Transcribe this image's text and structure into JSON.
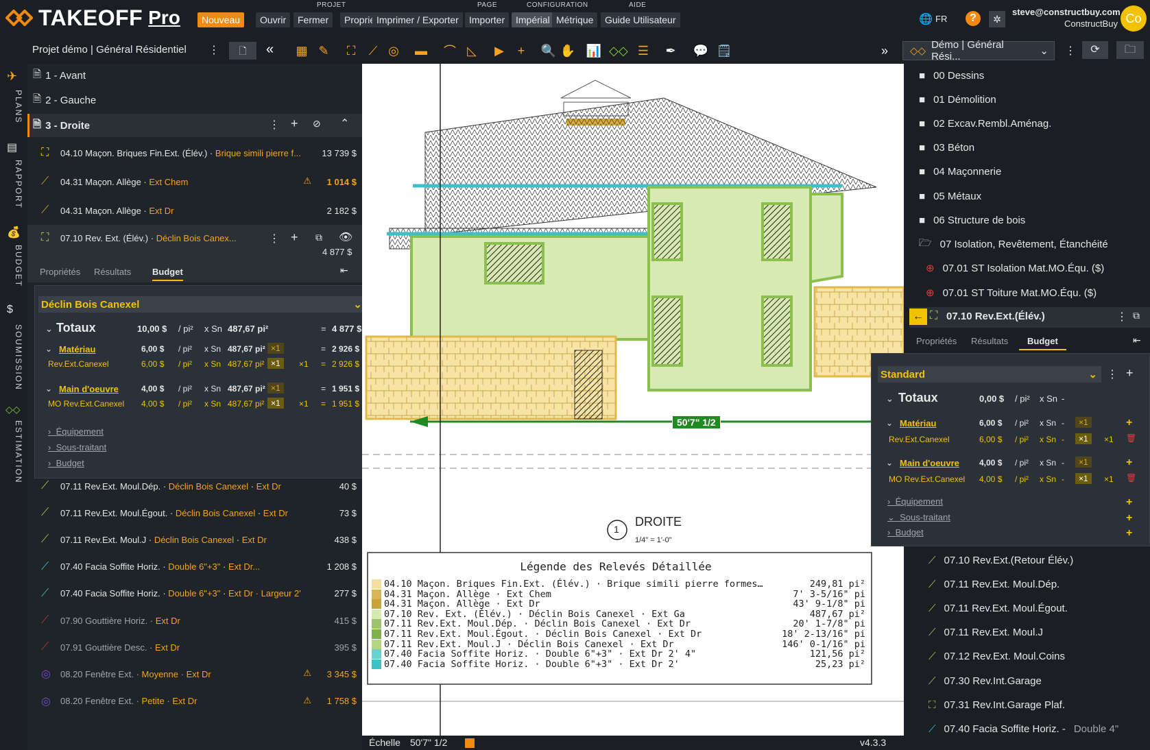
{
  "app": {
    "name_main": "TAKEOFF",
    "name_pro": "Pro",
    "lang": "FR",
    "user_email": "steve@constructbuy.com",
    "user_company": "ConstructBuy",
    "avatar": "Co"
  },
  "menu_groups": {
    "projet": "PROJET",
    "page": "PAGE",
    "configuration": "CONFIGURATION",
    "aide": "AIDE"
  },
  "menu": {
    "nouveau": "Nouveau",
    "ouvrir": "Ouvrir",
    "fermer": "Fermer",
    "proprietes": "Propriétés",
    "imprimer": "Imprimer / Exporter",
    "importer": "Importer",
    "imperial": "Impérial",
    "metrique": "Métrique",
    "guide": "Guide Utilisateur"
  },
  "toolbar": {
    "project_title": "Projet démo | Général Résidentiel",
    "project_select": "Démo | Général Rési..."
  },
  "rail": {
    "plans": "PLANS",
    "rapport": "RAPPORT",
    "budget": "BUDGET",
    "soumission": "SOUMISSION",
    "estimation": "ESTIMATION"
  },
  "pages": [
    "1 - Avant",
    "2 - Gauche",
    "3 - Droite"
  ],
  "rows_top": [
    {
      "name": "04.10 Maçon. Briques Fin.Ext. (Élév.)",
      "sub": "Brique simili pierre f...",
      "price": "13 739 $"
    },
    {
      "name": "04.31 Maçon. Allège",
      "sub": "Ext Chem",
      "price": "1 014 $"
    },
    {
      "name": "04.31 Maçon. Allège",
      "sub": "Ext Dr",
      "price": "2 182 $"
    }
  ],
  "selected_row": {
    "name": "07.10 Rev. Ext. (Élév.)",
    "sub": "Déclin Bois Canex...",
    "price": "4 877 $"
  },
  "tabs": {
    "proprietes": "Propriétés",
    "resultats": "Résultats",
    "budget": "Budget"
  },
  "left_budget": {
    "template": "Déclin Bois Canexel",
    "totaux": {
      "label": "Totaux",
      "rate": "10,00 $",
      "unit": "/ pi²",
      "mult": "x Sn",
      "qty": "487,67 pi²",
      "eq": "=",
      "total": "4 877 $"
    },
    "materiau": {
      "label": "Matériau",
      "rate": "6,00 $",
      "unit": "/ pi²",
      "mult": "x Sn",
      "qty": "487,67 pi²",
      "x1": "×1",
      "eq": "=",
      "total": "2 926 $",
      "item": "Rev.Ext.Canexel",
      "item_total": "2 926 $"
    },
    "mo": {
      "label": "Main d'oeuvre",
      "rate": "4,00 $",
      "unit": "/ pi²",
      "mult": "x Sn",
      "qty": "487,67 pi²",
      "x1": "×1",
      "eq": "=",
      "total": "1 951 $",
      "item": "MO Rev.Ext.Canexel",
      "item_total": "1 951 $"
    },
    "equipement": "Équipement",
    "sous_traitant": "Sous-traitant",
    "budget": "Budget"
  },
  "rows_bottom": [
    {
      "name": "07.11 Rev.Ext. Moul.Dép.",
      "sub": "Déclin Bois Canexel",
      "sub2": "Ext Dr",
      "price": "40 $"
    },
    {
      "name": "07.11 Rev.Ext. Moul.Égout.",
      "sub": "Déclin Bois Canexel",
      "sub2": "Ext Dr",
      "price": "73 $"
    },
    {
      "name": "07.11 Rev.Ext. Moul.J",
      "sub": "Déclin Bois Canexel",
      "sub2": "Ext Dr",
      "price": "438 $"
    },
    {
      "name": "07.40 Facia Soffite Horiz.",
      "sub": "Double 6\"+3\"",
      "sub2": "Ext Dr...",
      "price": "1 208 $"
    },
    {
      "name": "07.40 Facia Soffite Horiz.",
      "sub": "Double 6\"+3\"",
      "sub2": "Ext Dr · Largeur 2'",
      "price": "277 $"
    },
    {
      "name": "07.90 Gouttière Horiz.",
      "sub": "",
      "sub2": "Ext Dr",
      "price": "415 $"
    },
    {
      "name": "07.91 Gouttière Desc.",
      "sub": "",
      "sub2": "Ext Dr",
      "price": "395 $"
    },
    {
      "name": "08.20 Fenêtre Ext.",
      "sub": "Moyenne",
      "sub2": "Ext Dr",
      "price": "3 345 $"
    },
    {
      "name": "08.20 Fenêtre Ext.",
      "sub": "Petite",
      "sub2": "Ext Dr",
      "price": "1 758 $"
    }
  ],
  "drawing": {
    "measure": "50'7\" 1/2",
    "title": "DROITE",
    "num": "1",
    "scale": "1/4\" = 1'-0\"",
    "legend_title": "Légende des Relevés Détaillée",
    "legend": [
      {
        "t": "04.10 Maçon. Briques Fin.Ext. (Élév.) · Brique simili pierre formes…",
        "v": "249,81 pi²",
        "c": "#f3dfa0"
      },
      {
        "t": "04.31 Maçon. Allège · Ext Chem",
        "v": "7' 3-5/16\" pi",
        "c": "#d8b45a"
      },
      {
        "t": "04.31 Maçon. Allège · Ext Dr",
        "v": "43' 9-1/8\" pi",
        "c": "#c9a23c"
      },
      {
        "t": "07.10 Rev. Ext. (Élév.) · Déclin Bois Canexel · Ext Ga",
        "v": "487,67 pi²",
        "c": "#d6eab2"
      },
      {
        "t": "07.11 Rev.Ext. Moul.Dép. · Déclin Bois Canexel · Ext Dr",
        "v": "20' 1-7/8\" pi",
        "c": "#9cc46a"
      },
      {
        "t": "07.11 Rev.Ext. Moul.Égout. · Déclin Bois Canexel · Ext Dr",
        "v": "18' 2-13/16\" pi",
        "c": "#7eb24c"
      },
      {
        "t": "07.11 Rev.Ext. Moul.J · Déclin Bois Canexel · Ext Dr",
        "v": "146' 0-1/16\" pi",
        "c": "#b4d67e"
      },
      {
        "t": "07.40 Facia Soffite Horiz. · Double 6\"+3\" · Ext Dr 2' 4\"",
        "v": "121,56 pi²",
        "c": "#6ad0d0"
      },
      {
        "t": "07.40 Facia Soffite Horiz. · Double 6\"+3\" · Ext Dr 2'",
        "v": "25,23 pi²",
        "c": "#3ec0c8"
      }
    ]
  },
  "status": {
    "label": "Échelle",
    "value": "50'7\" 1/2",
    "version": "v4.3.3"
  },
  "folders": [
    "00 Dessins",
    "01 Démolition",
    "02 Excav.Rembl.Aménag.",
    "03 Béton",
    "04 Maçonnerie",
    "05 Métaux",
    "06 Structure de bois",
    "07 Isolation, Revêtement, Étanchéité"
  ],
  "subfolders": [
    "07.01 ST Isolation Mat.MO.Équ. ($)",
    "07.01 ST Toiture Mat.MO.Équ. ($)"
  ],
  "right_selected": "07.10 Rev.Ext.(Élév.)",
  "right_budget": {
    "template": "Standard",
    "totaux": {
      "label": "Totaux",
      "rate": "0,00 $",
      "unit": "/ pi²",
      "mult": "x Sn",
      "dash": "-"
    },
    "materiau": {
      "label": "Matériau",
      "rate": "6,00 $",
      "unit": "/ pi²",
      "mult": "x Sn",
      "dash": "-",
      "x1": "×1",
      "item": "Rev.Ext.Canexel"
    },
    "mo": {
      "label": "Main d'oeuvre",
      "rate": "4,00 $",
      "unit": "/ pi²",
      "mult": "x Sn",
      "dash": "-",
      "x1": "×1",
      "item": "MO Rev.Ext.Canexel"
    },
    "equipement": "Équipement",
    "sous_traitant": "Sous-traitant",
    "budget": "Budget"
  },
  "right_items": [
    {
      "name": "07.10 Rev.Ext.(Retour Élév.)",
      "sub": ""
    },
    {
      "name": "07.11 Rev.Ext. Moul.Dép.",
      "sub": ""
    },
    {
      "name": "07.11 Rev.Ext. Moul.Égout.",
      "sub": ""
    },
    {
      "name": "07.11 Rev.Ext. Moul.J",
      "sub": ""
    },
    {
      "name": "07.12 Rev.Ext. Moul.Coins",
      "sub": ""
    },
    {
      "name": "07.30 Rev.Int.Garage",
      "sub": ""
    },
    {
      "name": "07.31 Rev.Int.Garage Plaf.",
      "sub": ""
    },
    {
      "name": "07.40 Facia Soffite Horiz. -",
      "sub": "Double 4\""
    }
  ]
}
